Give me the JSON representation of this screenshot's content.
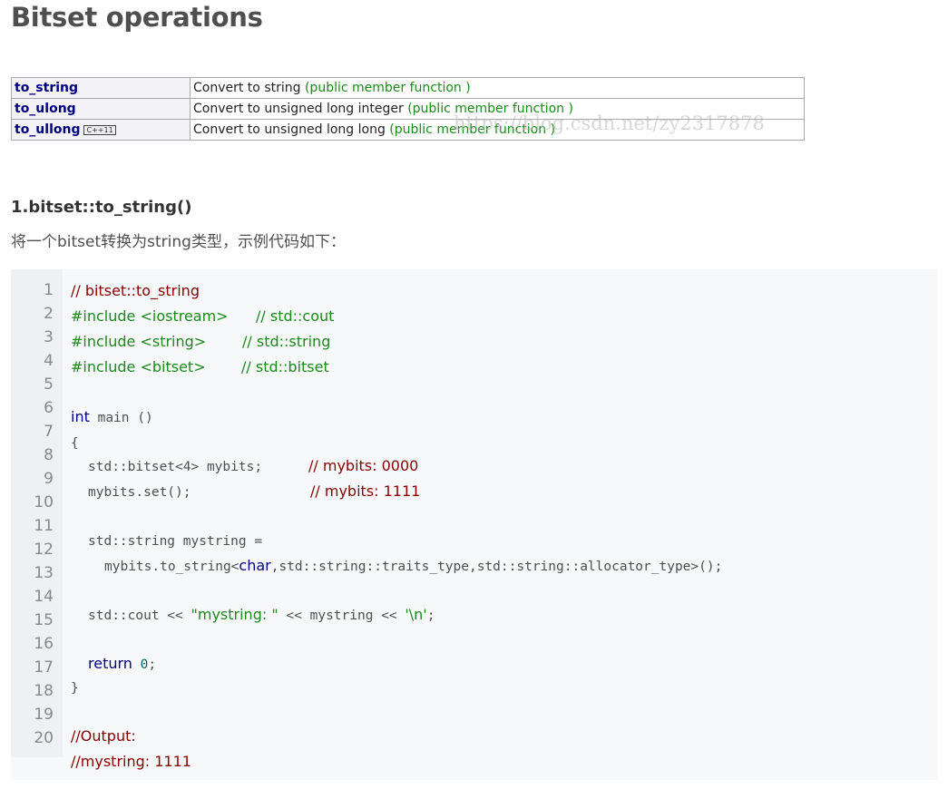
{
  "page_title": "Bitset operations",
  "watermark": "https://blog.csdn.net/zy2317878",
  "table": {
    "rows": [
      {
        "name": "to_string",
        "badge": "",
        "desc": "Convert to string",
        "kind": "(public member function )"
      },
      {
        "name": "to_ulong",
        "badge": "",
        "desc": "Convert to unsigned long integer",
        "kind": "(public member function )"
      },
      {
        "name": "to_ullong",
        "badge": "C++11",
        "desc": "Convert to unsigned long long",
        "kind": "(public member function )"
      }
    ]
  },
  "section": {
    "heading": "1.bitset::to_string()",
    "intro": "将一个bitset转换为string类型，示例代码如下："
  },
  "code": {
    "line_numbers": [
      "1",
      "2",
      "3",
      "4",
      "5",
      "6",
      "7",
      "8",
      "9",
      "10",
      "11",
      "12",
      "13",
      "14",
      "15",
      "16",
      "17",
      "18",
      "19",
      "20"
    ],
    "l1": "// bitset::to_string",
    "l2_inc": "#include <iostream>",
    "l2_cm": "// std::cout",
    "l3_inc": "#include <string>",
    "l3_cm": "// std::string",
    "l4_inc": "#include <bitset>",
    "l4_cm": "// std::bitset",
    "l6_kw": "int",
    "l6_rest": " main ()",
    "l7": "{",
    "l8_a": "std::bitset<4>",
    "l8_b": " mybits;",
    "l8_cm": "// mybits: 0000",
    "l9_a": "mybits.set();",
    "l9_cm": "// mybits: 1111",
    "l11_a": "std::string",
    "l11_b": " mystring =",
    "l12_a": "mybits.to_string<",
    "l12_kw": "char",
    "l12_b": ",std::string::traits_type,std::string::allocator_type>();",
    "l14_a": "std::cout << ",
    "l14_str": "\"mystring: \"",
    "l14_b": " << mystring << ",
    "l14_chr": "'\\n'",
    "l14_c": ";",
    "l16_kw": "return",
    "l16_num": " 0",
    "l16_c": ";",
    "l17": "}",
    "l19": "//Output:",
    "l20": "//mystring: 1111"
  }
}
